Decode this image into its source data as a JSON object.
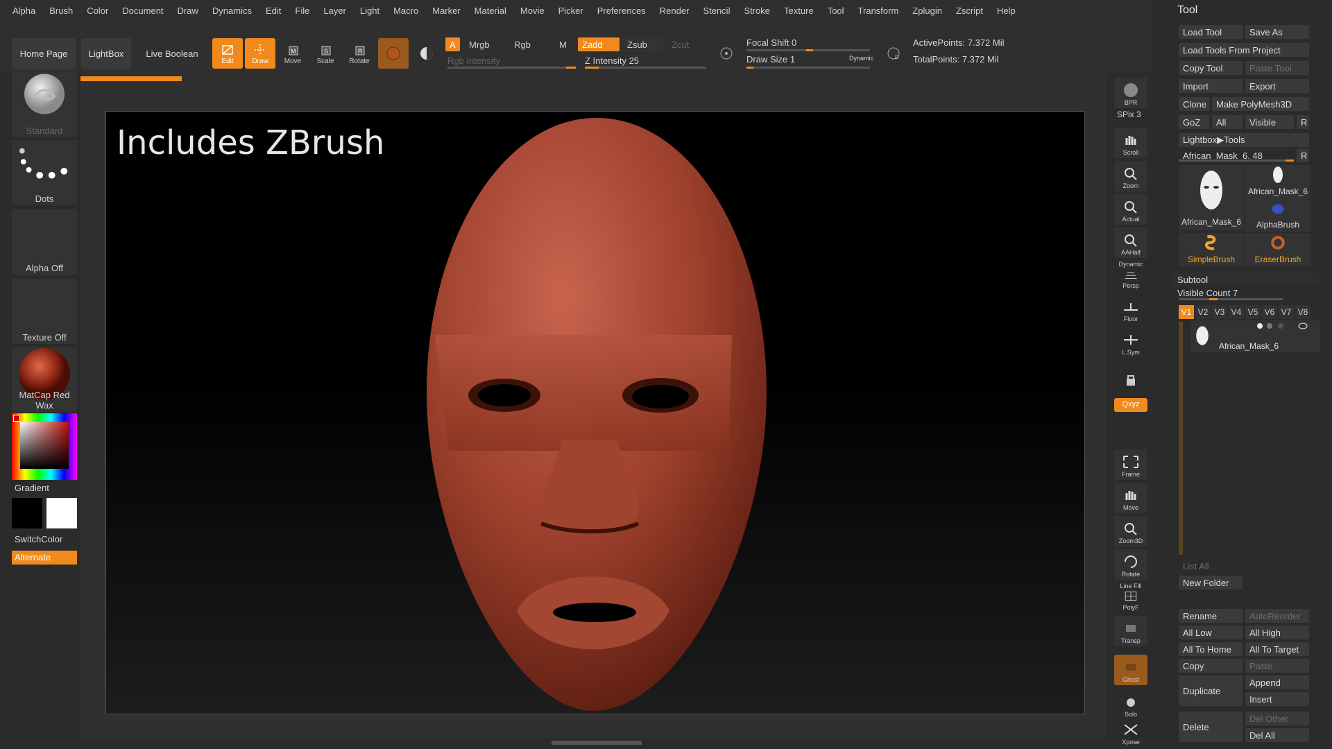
{
  "menu": [
    "Alpha",
    "Brush",
    "Color",
    "Document",
    "Draw",
    "Dynamics",
    "Edit",
    "File",
    "Layer",
    "Light",
    "Macro",
    "Marker",
    "Material",
    "Movie",
    "Picker",
    "Preferences",
    "Render",
    "Stencil",
    "Stroke",
    "Texture",
    "Tool",
    "Transform",
    "Zplugin",
    "Zscript",
    "Help"
  ],
  "toolbar": {
    "home": "Home Page",
    "lightbox": "LightBox",
    "live_boolean": "Live Boolean",
    "edit": "Edit",
    "draw": "Draw",
    "move": "Move",
    "scale": "Scale",
    "rotate": "Rotate",
    "a": "A",
    "mrgb": "Mrgb",
    "rgb": "Rgb",
    "m": "M",
    "rgb_intensity": "Rgb Intensity",
    "zadd": "Zadd",
    "zsub": "Zsub",
    "zcut": "Zcut",
    "z_intensity": "Z Intensity 25",
    "z_intensity_level": 0.25,
    "focal_shift": "Focal Shift 0",
    "draw_size": "Draw Size 1",
    "dynamic": "Dynamic",
    "active_points": "ActivePoints: 7.372 Mil",
    "total_points": "TotalPoints: 7.372 Mil"
  },
  "left": {
    "brush": "Standard",
    "stroke": "Dots",
    "alpha": "Alpha Off",
    "texture": "Texture Off",
    "material": "MatCap Red Wax",
    "gradient": "Gradient",
    "switchcolor": "SwitchColor",
    "alternate": "Alternate"
  },
  "canvas": {
    "headline": "Includes ZBrush"
  },
  "shelf": {
    "bpr": "BPR",
    "spix": "SPix 3",
    "scroll": "Scroll",
    "zoom": "Zoom",
    "actual": "Actual",
    "aahalf": "AAHalf",
    "dynamic": "Dynamic",
    "persp": "Persp",
    "floor": "Floor",
    "lsym": "L.Sym",
    "xyz": "Qxyz",
    "frame": "Frame",
    "move": "Move",
    "zoom3d": "Zoom3D",
    "rotate": "Rotate",
    "linefill": "Line Fill",
    "polyf": "PolyF",
    "transp": "Transp",
    "ghost": "Ghost",
    "solo": "Solo",
    "xpose": "Xpose"
  },
  "tool": {
    "title": "Tool",
    "load_tool": "Load Tool",
    "save_as": "Save As",
    "load_from_project": "Load Tools From Project",
    "copy_tool": "Copy Tool",
    "paste_tool": "Paste Tool",
    "import": "Import",
    "export": "Export",
    "clone": "Clone",
    "make_polymesh": "Make PolyMesh3D",
    "goz": "GoZ",
    "all": "All",
    "visible": "Visible",
    "r": "R",
    "lightbox_tools": "Lightbox▶Tools",
    "current_tool": "African_Mask_6. 48",
    "thumbs": [
      "African_Mask_6",
      "African_Mask_6",
      "AlphaBrush",
      "SimpleBrush",
      "EraserBrush"
    ],
    "subtool": "Subtool",
    "visible_count": "Visible Count 7",
    "views": [
      "V1",
      "V2",
      "V3",
      "V4",
      "V5",
      "V6",
      "V7",
      "V8"
    ],
    "subtool_item": "African_Mask_6",
    "list_all": "List All",
    "new_folder": "New Folder",
    "rename": "Rename",
    "autoreorder": "AutoReorder",
    "all_low": "All Low",
    "all_high": "All High",
    "all_to_home": "All To Home",
    "all_to_target": "All To Target",
    "copy": "Copy",
    "paste": "Paste",
    "duplicate": "Duplicate",
    "append": "Append",
    "insert": "Insert",
    "delete": "Delete",
    "del_other": "Del Other",
    "del_all": "Del All"
  }
}
